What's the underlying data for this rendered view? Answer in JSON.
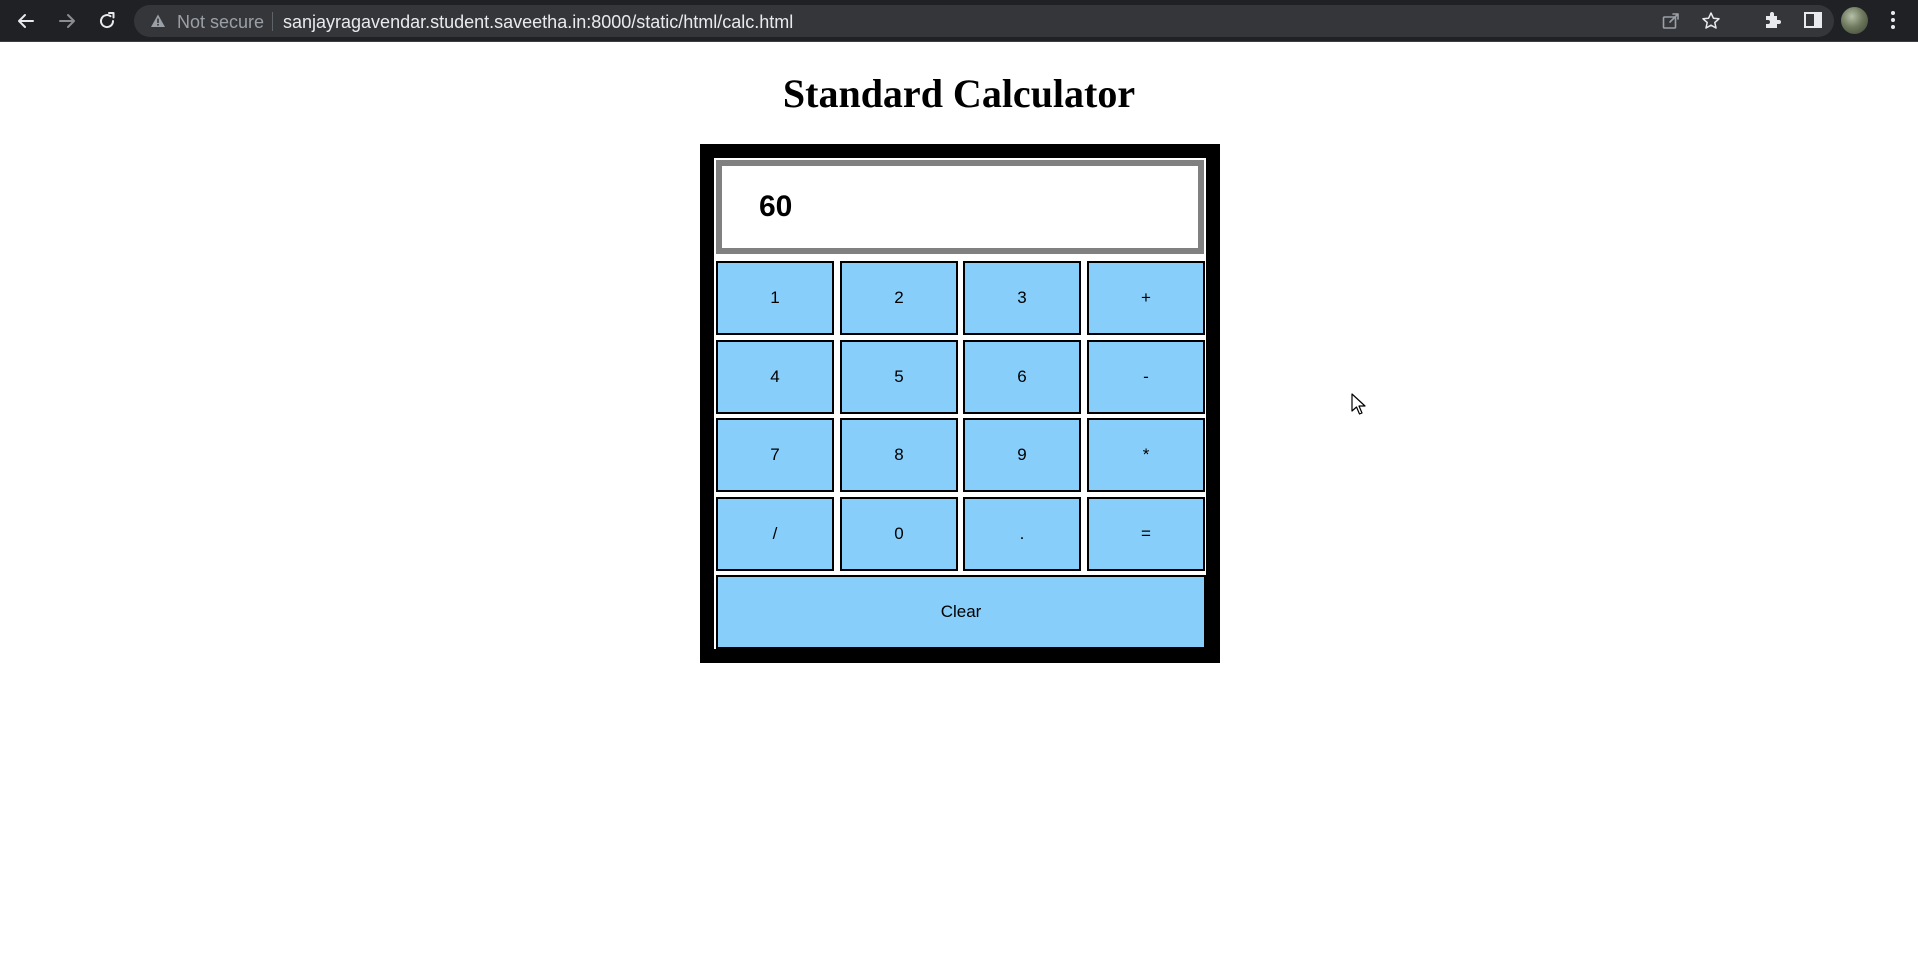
{
  "browser": {
    "security_label": "Not secure",
    "url": "sanjayragavendar.student.saveetha.in:8000/static/html/calc.html"
  },
  "page": {
    "title": "Standard Calculator"
  },
  "calculator": {
    "display_value": "60",
    "keys": [
      [
        "1",
        "2",
        "3",
        "+"
      ],
      [
        "4",
        "5",
        "6",
        "-"
      ],
      [
        "7",
        "8",
        "9",
        "*"
      ],
      [
        "/",
        "0",
        ".",
        "="
      ]
    ],
    "clear_label": "Clear"
  },
  "colors": {
    "key_background": "#87cefa",
    "frame": "#000000",
    "display_border": "#808080"
  }
}
